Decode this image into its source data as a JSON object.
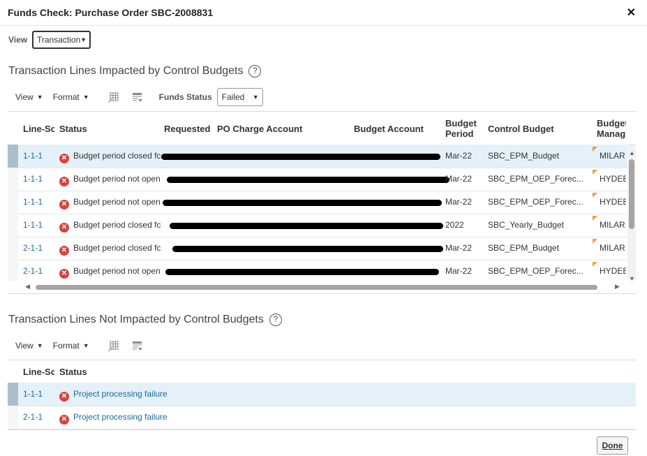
{
  "dialog": {
    "title": "Funds Check: Purchase Order SBC-2008831",
    "close": "✕"
  },
  "view": {
    "label": "View",
    "value": "Transaction"
  },
  "impacted": {
    "title": "Transaction Lines Impacted by Control Budgets",
    "help": "?",
    "toolbar": {
      "view": "View",
      "format": "Format",
      "funds_status_label": "Funds Status",
      "funds_status_value": "Failed"
    },
    "columns": [
      "Line-Sc",
      "Status",
      "Requested",
      "PO Charge Account",
      "Budget Account",
      "Budget Period",
      "Control Budget",
      "Budget Manag"
    ],
    "rows": [
      {
        "line": "1-1-1",
        "status": "Budget period closed fc",
        "period": "Mar-22",
        "budget": "SBC_EPM_Budget",
        "manager": "MILAR"
      },
      {
        "line": "1-1-1",
        "status": "Budget period not open",
        "period": "Mar-22",
        "budget": "SBC_EPM_OEP_Forec...",
        "manager": "HYDEE"
      },
      {
        "line": "1-1-1",
        "status": "Budget period not open",
        "period": "Mar-22",
        "budget": "SBC_EPM_OEP_Forec...",
        "manager": "HYDEE"
      },
      {
        "line": "1-1-1",
        "status": "Budget period closed fc",
        "period": "2022",
        "budget": "SBC_Yearly_Budget",
        "manager": "MILAR"
      },
      {
        "line": "2-1-1",
        "status": "Budget period closed fc",
        "period": "Mar-22",
        "budget": "SBC_EPM_Budget",
        "manager": "MILAR"
      },
      {
        "line": "2-1-1",
        "status": "Budget period not open",
        "period": "Mar-22",
        "budget": "SBC_EPM_OEP_Forec...",
        "manager": "HYDEE"
      }
    ]
  },
  "not_impacted": {
    "title": "Transaction Lines Not Impacted by Control Budgets",
    "help": "?",
    "toolbar": {
      "view": "View",
      "format": "Format"
    },
    "columns": [
      "Line-Sc",
      "Status"
    ],
    "rows": [
      {
        "line": "1-1-1",
        "status": "Project processing failure"
      },
      {
        "line": "2-1-1",
        "status": "Project processing failure"
      }
    ]
  },
  "done_label": "Done"
}
